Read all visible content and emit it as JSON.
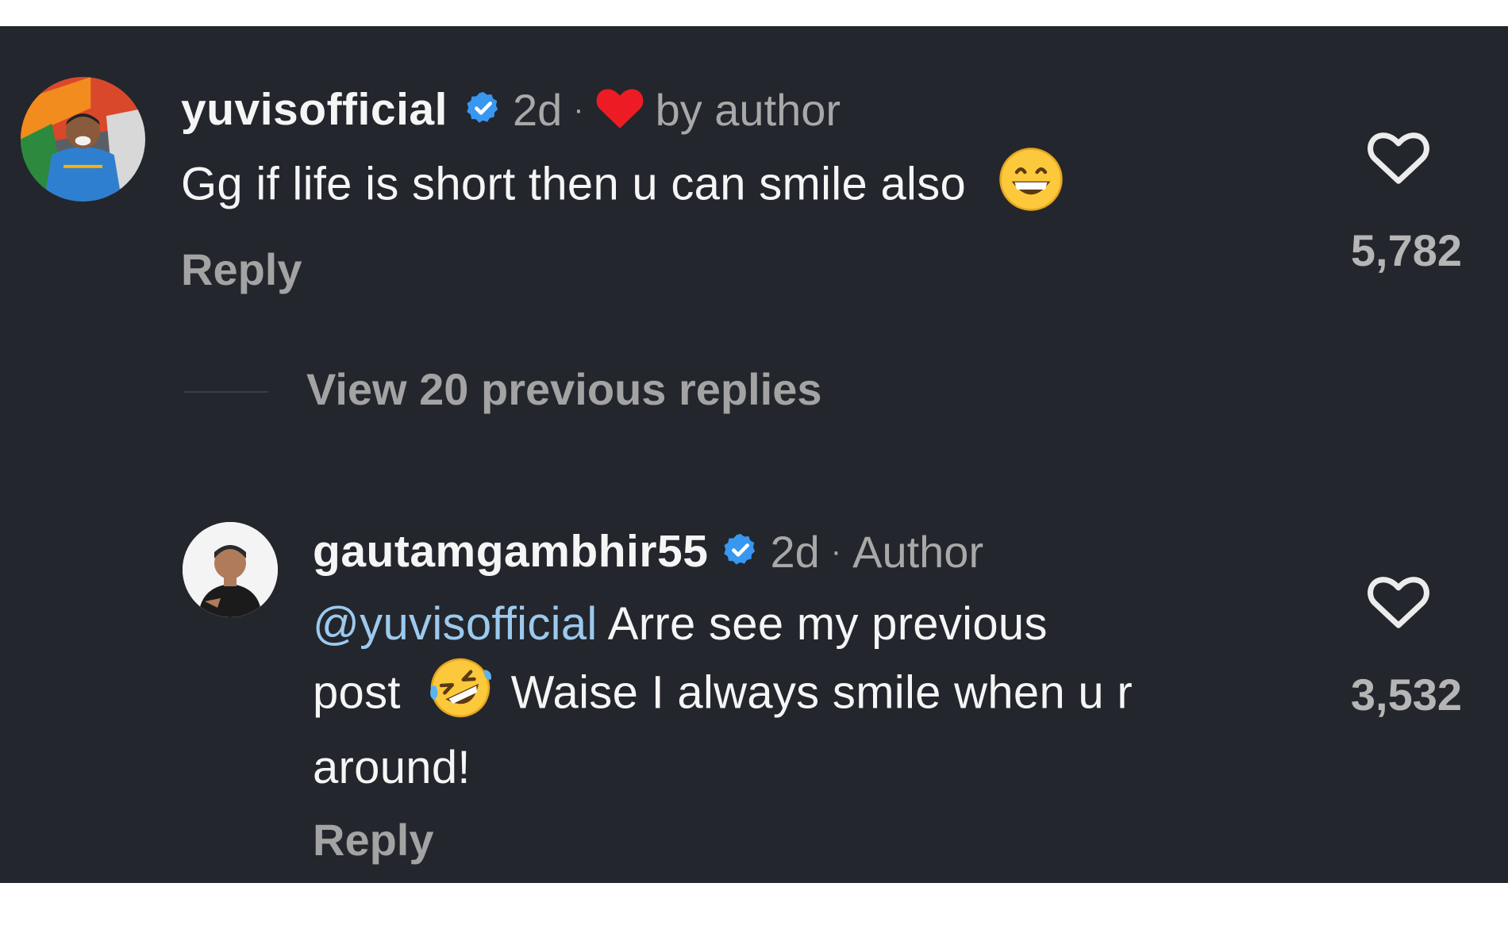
{
  "comments": [
    {
      "username": "yuvisofficial",
      "verified": true,
      "time": "2d",
      "separator": "·",
      "liked_by_author_label": "by author",
      "text": "Gg if life is short then u can smile also",
      "emoji": "grinning-face-with-smiling-eyes",
      "reply_label": "Reply",
      "likes": "5,782",
      "avatar_icon": "profile-photo-yuvisofficial"
    },
    {
      "username": "gautamgambhir55",
      "verified": true,
      "time": "2d",
      "separator": "·",
      "author_tag": "Author",
      "mention": "@yuvisofficial",
      "text_part1": " Arre see my previous",
      "text_part2": "post",
      "emoji": "rolling-on-the-floor-laughing",
      "text_part3": " Waise I always smile when u r",
      "text_part4": "around!",
      "reply_label": "Reply",
      "likes": "3,532",
      "avatar_icon": "profile-photo-gautamgambhir55"
    }
  ],
  "thread": {
    "view_replies_label": "View 20 previous replies"
  },
  "colors": {
    "background": "#23262c",
    "verified_blue": "#3897f0",
    "mention_blue": "#9cc9ee",
    "heart_red": "#ed1c24",
    "muted_text": "#a8a8a8"
  }
}
